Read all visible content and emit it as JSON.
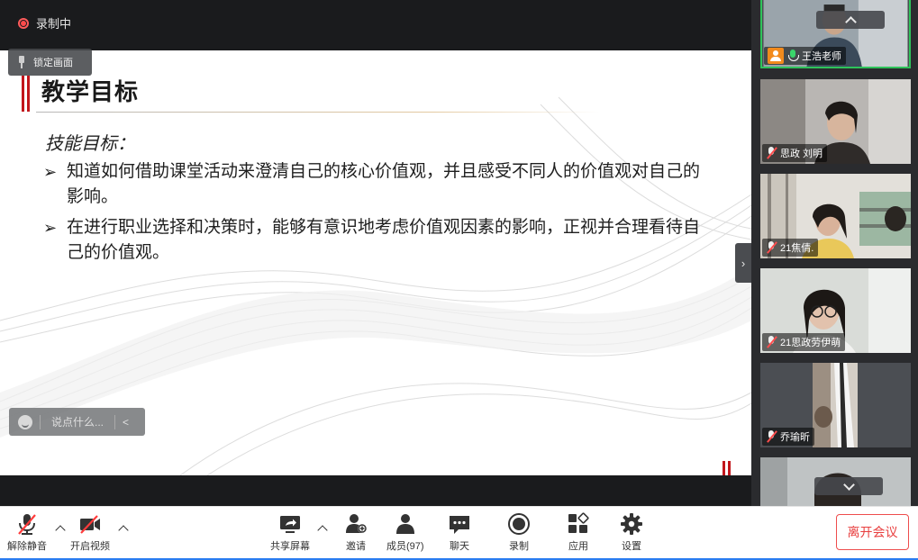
{
  "recording": {
    "status_label": "录制中"
  },
  "lock_view": {
    "label": "锁定画面"
  },
  "slide": {
    "title": "教学目标",
    "subheading": "技能目标：",
    "bullet_mark": "➢",
    "bullets": [
      "知道如何借助课堂活动来澄清自己的核心价值观，并且感受不同人的价值观对自己的影响。",
      "在进行职业选择和决策时，能够有意识地考虑价值观因素的影响，正视并合理看待自己的价值观。"
    ]
  },
  "chat": {
    "placeholder": "说点什么...",
    "collapse_glyph": "<"
  },
  "participants": [
    {
      "name": "王浩老师",
      "mic": "on",
      "host": true,
      "active": true
    },
    {
      "name": "思政 刘明",
      "mic": "muted"
    },
    {
      "name": "21焦倩.",
      "mic": "muted"
    },
    {
      "name": "21思政劳伊萌",
      "mic": "muted"
    },
    {
      "name": "乔瑜昕",
      "mic": "muted"
    }
  ],
  "toolbar": {
    "unmute": "解除静音",
    "start_video": "开启视频",
    "share_screen": "共享屏幕",
    "invite": "邀请",
    "members": "成员(97)",
    "chat": "聊天",
    "record": "录制",
    "apps": "应用",
    "settings": "设置",
    "leave": "离开会议"
  },
  "colors": {
    "accent_red": "#c2161c",
    "active_green": "#2ec35a",
    "leave_red": "#e83f3f"
  }
}
